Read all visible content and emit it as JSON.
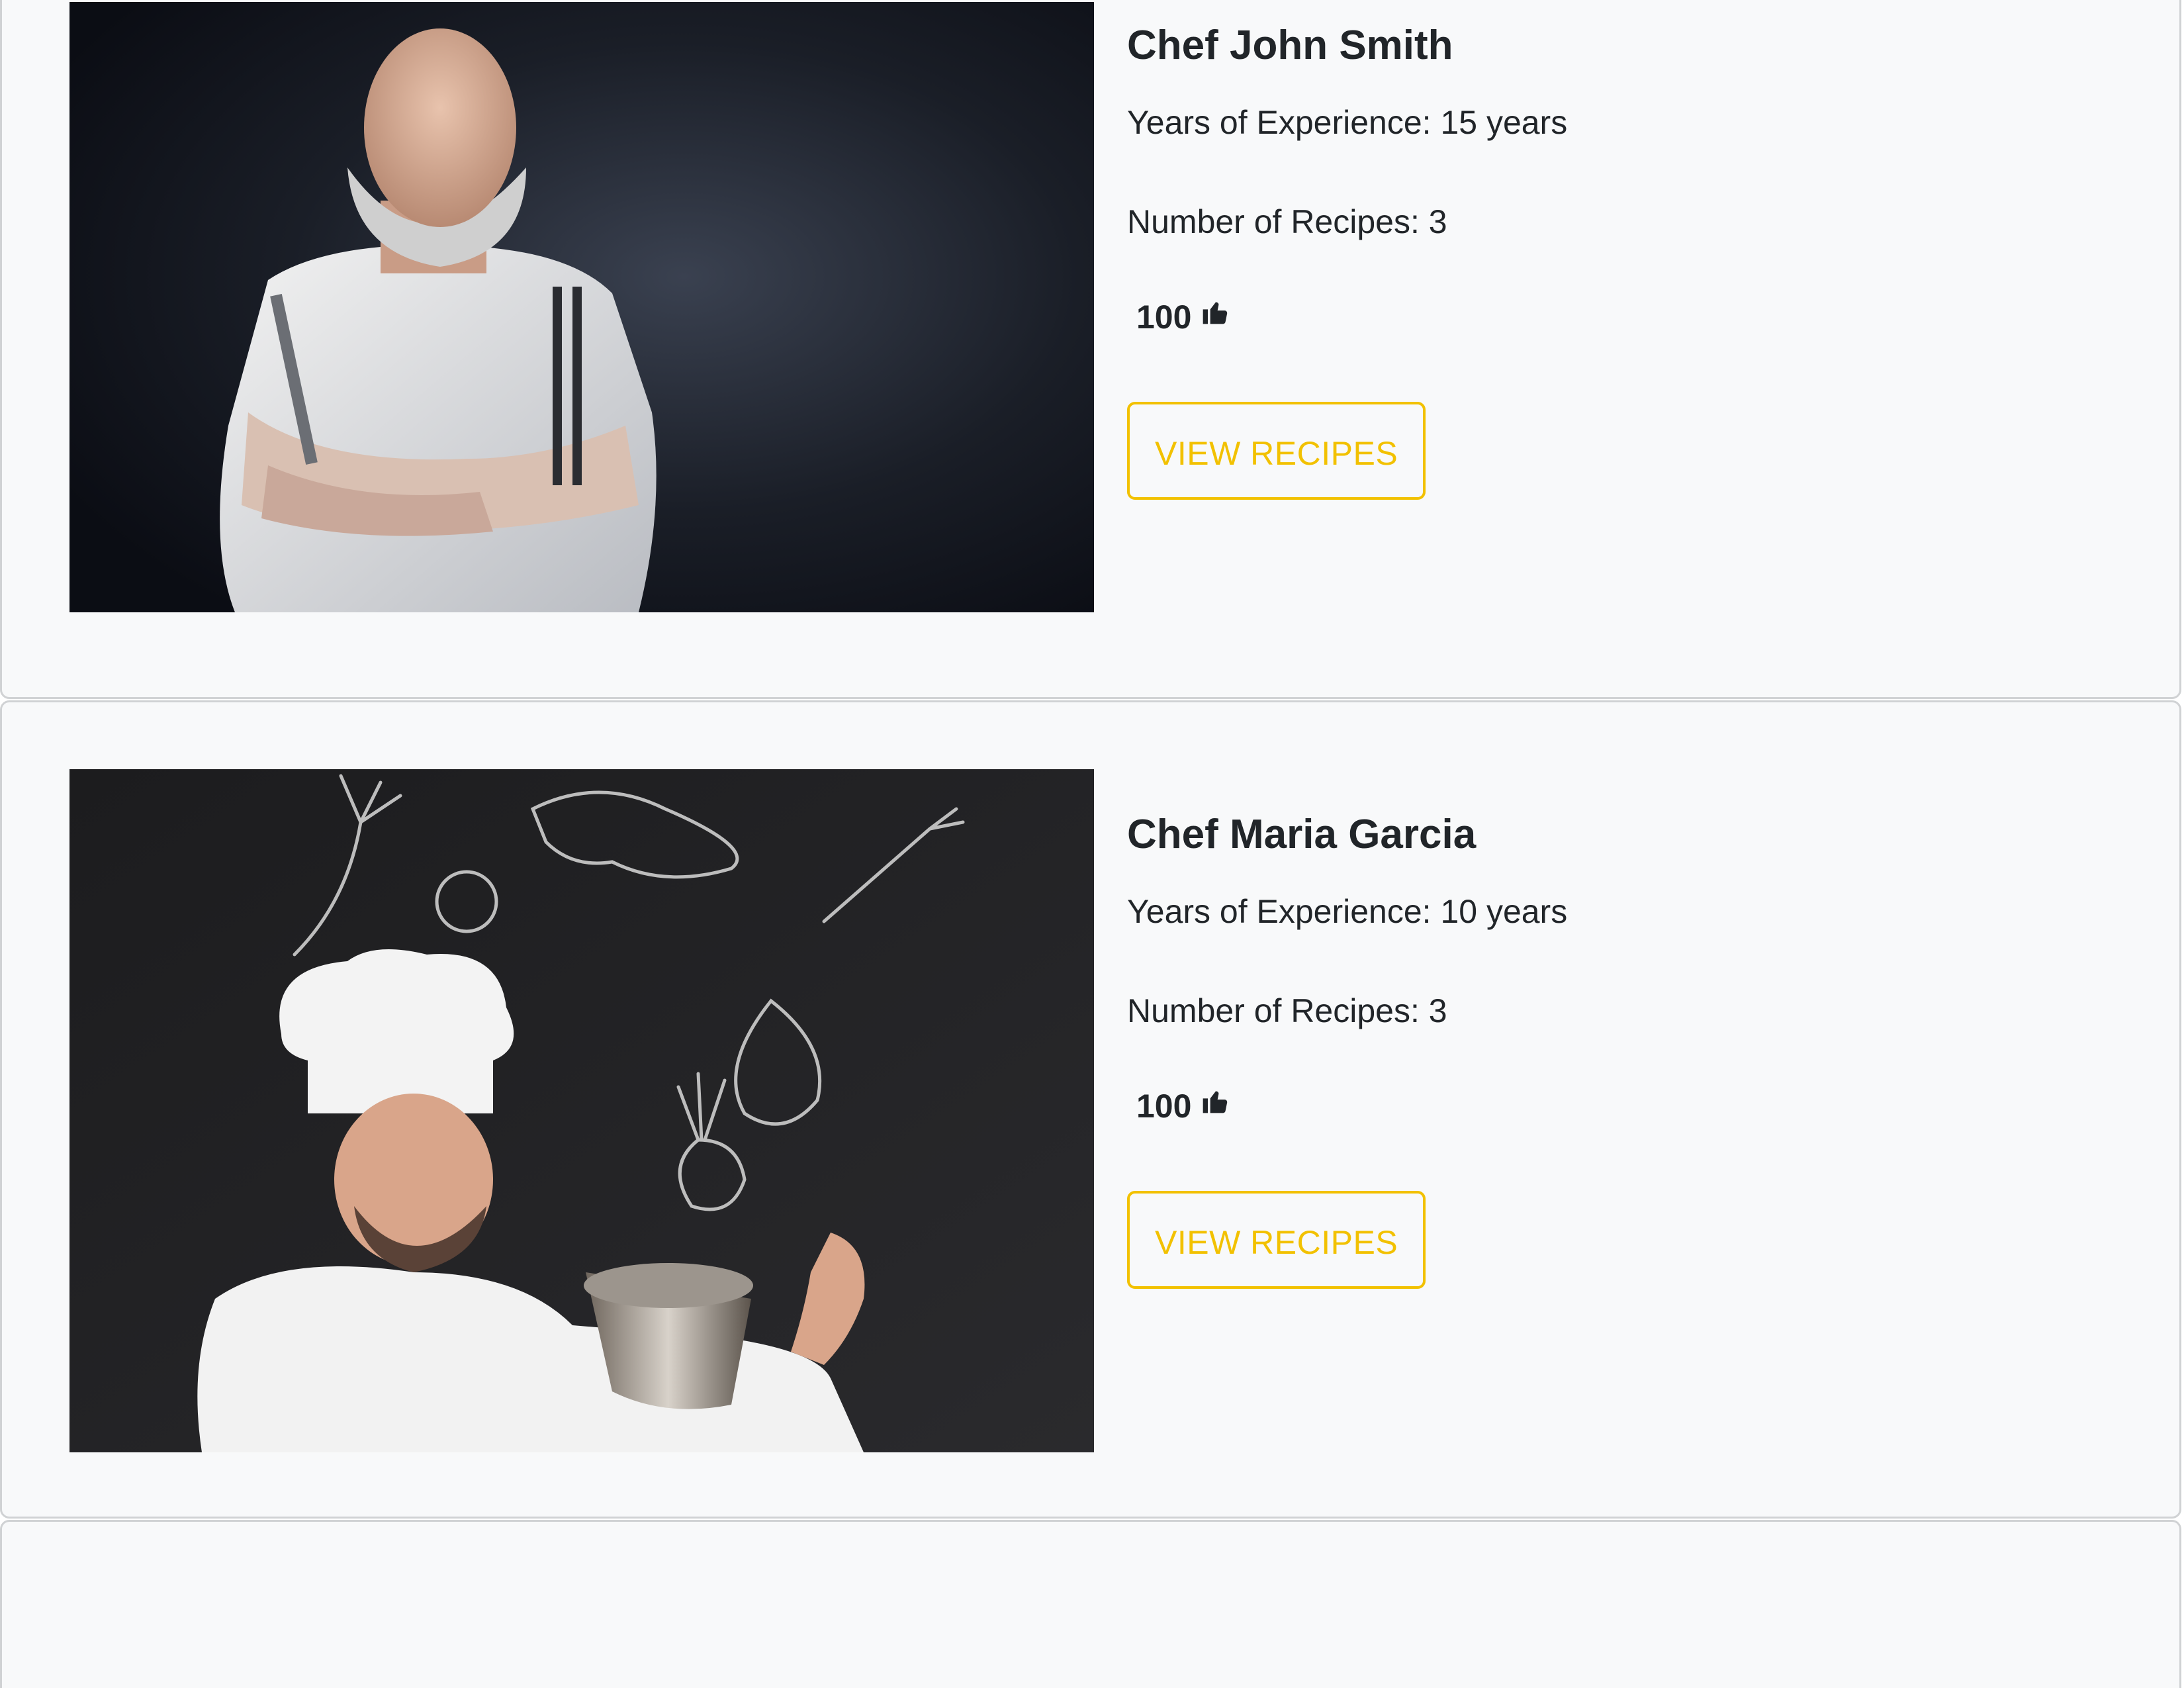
{
  "chefs": [
    {
      "name": "Chef John Smith",
      "experience": "Years of Experience: 15 years",
      "recipes": "Number of Recipes: 3",
      "likes": "100",
      "button_label": "VIEW RECIPES",
      "photo": "chef-portrait-arms-crossed"
    },
    {
      "name": "Chef Maria Garcia",
      "experience": "Years of Experience: 10 years",
      "recipes": "Number of Recipes: 3",
      "likes": "100",
      "button_label": "VIEW RECIPES",
      "photo": "chef-with-pot-chalkboard"
    }
  ],
  "icons": {
    "likes_icon": "thumbs-up-icon"
  },
  "colors": {
    "accent": "#f2c100",
    "card_background": "#f8f9fa",
    "card_border": "#d0d2d4",
    "text": "#212529"
  }
}
